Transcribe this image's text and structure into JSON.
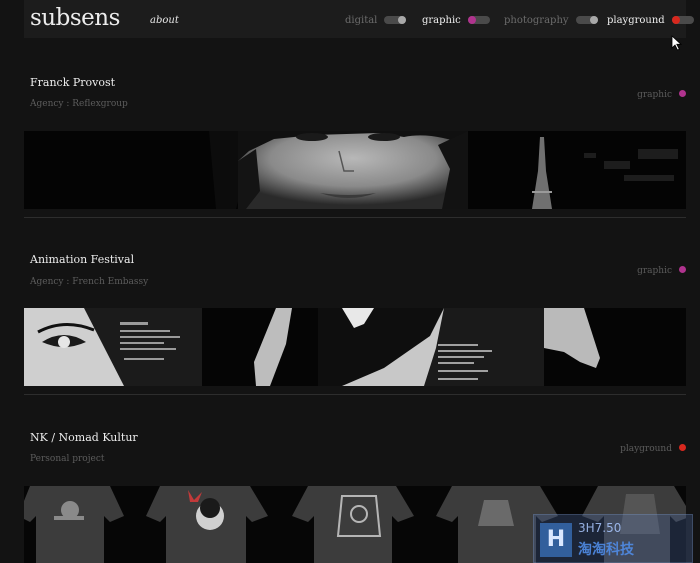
{
  "header": {
    "logo": "subsens",
    "about": "about",
    "filters": [
      {
        "label": "digital",
        "active": false
      },
      {
        "label": "graphic",
        "active": true,
        "color": "#b0338e"
      },
      {
        "label": "photography",
        "active": false
      },
      {
        "label": "playground",
        "active": true,
        "color": "#d8281e"
      }
    ]
  },
  "projects": [
    {
      "title": "Franck Provost",
      "subtitle": "Agency : Reflexgroup",
      "category": "graphic",
      "category_color": "#b0338e",
      "image": "project-banner-woman-eiffel"
    },
    {
      "title": "Animation Festival",
      "subtitle": "Agency : French Embassy",
      "category": "graphic",
      "category_color": "#b0338e",
      "image": "project-banner-festival-posters"
    },
    {
      "title": "NK / Nomad Kultur",
      "subtitle": "Personal project",
      "category": "playground",
      "category_color": "#d8281e",
      "image": "project-banner-tshirts"
    }
  ],
  "watermark": {
    "logo": "H",
    "line1": "3H7.50",
    "line2": "淘淘科技"
  }
}
